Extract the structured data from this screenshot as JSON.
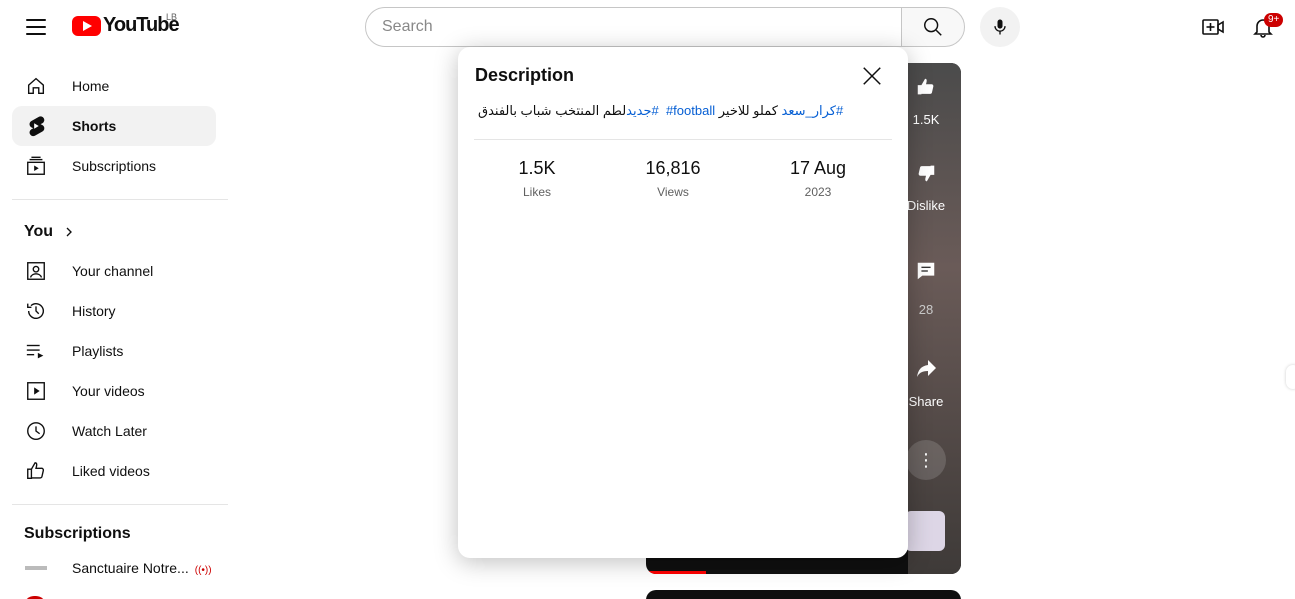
{
  "header": {
    "logo_text": "YouTube",
    "country_code": "LB",
    "search_placeholder": "Search",
    "notification_count": "9+"
  },
  "sidebar": {
    "main": [
      {
        "label": "Home",
        "icon": "home-icon"
      },
      {
        "label": "Shorts",
        "icon": "shorts-icon"
      },
      {
        "label": "Subscriptions",
        "icon": "subscriptions-icon"
      }
    ],
    "you_title": "You",
    "you_items": [
      {
        "label": "Your channel",
        "icon": "your-channel-icon"
      },
      {
        "label": "History",
        "icon": "history-icon"
      },
      {
        "label": "Playlists",
        "icon": "playlists-icon"
      },
      {
        "label": "Your videos",
        "icon": "your-videos-icon"
      },
      {
        "label": "Watch Later",
        "icon": "watch-later-icon"
      },
      {
        "label": "Liked videos",
        "icon": "liked-videos-icon"
      }
    ],
    "subscriptions_title": "Subscriptions",
    "subscriptions": [
      {
        "label": "Sanctuaire Notre..."
      }
    ]
  },
  "shorts": {
    "like_count": "1.5K",
    "dislike_label": "Dislike",
    "comment_count": "28",
    "share_label": "Share"
  },
  "modal": {
    "title": "Description",
    "description": {
      "tag_1": "#كرار_سعد",
      "text_1": " كملو للاخير ",
      "tag_2": "#football",
      "tag_3": " #جديد",
      "text_2": "لطم المنتخب شباب بالفندق"
    },
    "stats": [
      {
        "value": "1.5K",
        "label": "Likes"
      },
      {
        "value": "16,816",
        "label": "Views"
      },
      {
        "value": "17 Aug",
        "label": "2023"
      }
    ]
  },
  "colors": {
    "brand_red": "#ff0000",
    "link_blue": "#065fd4",
    "badge_red": "#cc0000"
  }
}
